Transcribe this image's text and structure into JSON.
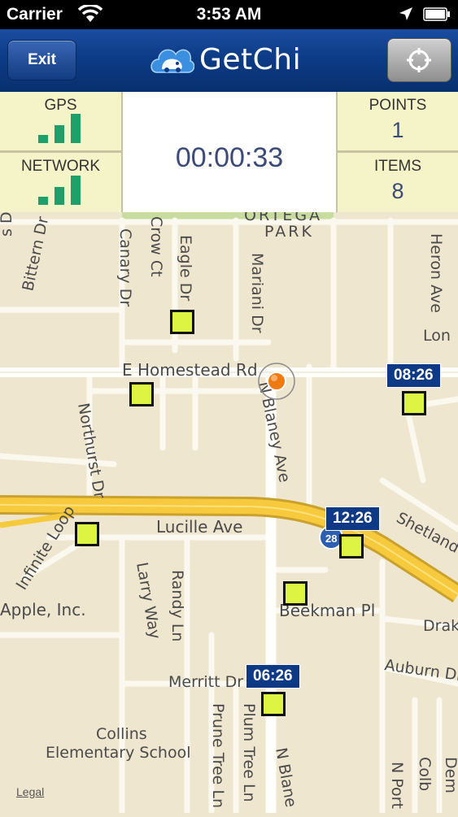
{
  "status_bar": {
    "carrier": "Carrier",
    "time": "3:53 AM"
  },
  "header": {
    "exit_label": "Exit",
    "app_name": "GetChi"
  },
  "stats": {
    "gps_label": "GPS",
    "network_label": "NETWORK",
    "timer": "00:00:33",
    "points_label": "POINTS",
    "points_value": "1",
    "items_label": "ITEMS",
    "items_value": "8"
  },
  "map": {
    "park_label": "ORTEGA",
    "park_label2": "PARK",
    "legal": "Legal",
    "highway_shield": "28",
    "streets": {
      "bittern": "Bittern Dr",
      "canary": "Canary Dr",
      "crow": "Crow Ct",
      "eagle": "Eagle Dr",
      "mariani": "Mariani Dr",
      "heron": "Heron Ave",
      "lon": "Lon",
      "homestead": "E Homestead Rd",
      "blaney": "N Blaney Ave",
      "northhurst": "Northurst Dr",
      "shetland": "Shetland",
      "lucille": "Lucille Ave",
      "infinite": "Infinite Loop",
      "larry": "Larry Way",
      "randy": "Randy Ln",
      "beekman": "Beekman Pl",
      "drake": "Drak",
      "apple": "Apple, Inc.",
      "auburn": "Auburn Dr",
      "merritt": "Merritt Dr",
      "plum": "Plum Tree Ln",
      "prune": "Prune Tree Ln",
      "nblaney2": "N Blane",
      "collins1": "Collins",
      "collins2": "Elementary School",
      "nport": "N Port",
      "colb": "Colb",
      "dem": "Dem",
      "sdr": "s Dr"
    },
    "time_labels": [
      "08:26",
      "12:26",
      "06:26"
    ]
  },
  "colors": {
    "marker": "#ddf442",
    "time_label_bg": "#0e3a85",
    "nav_bg": "#0d3b86",
    "signal_bar": "#1fa06a"
  }
}
